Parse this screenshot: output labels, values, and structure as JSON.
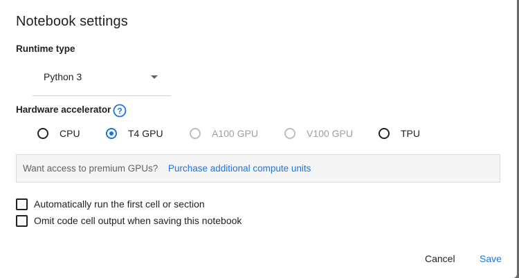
{
  "dialog": {
    "title": "Notebook settings"
  },
  "runtime": {
    "label": "Runtime type",
    "selected": "Python 3"
  },
  "hardware": {
    "label": "Hardware accelerator",
    "help_icon": "help-circle-icon",
    "options": [
      {
        "label": "CPU",
        "checked": false,
        "disabled": false
      },
      {
        "label": "T4 GPU",
        "checked": true,
        "disabled": false
      },
      {
        "label": "A100 GPU",
        "checked": false,
        "disabled": true
      },
      {
        "label": "V100 GPU",
        "checked": false,
        "disabled": true
      },
      {
        "label": "TPU",
        "checked": false,
        "disabled": false
      }
    ]
  },
  "premium": {
    "text": "Want access to premium GPUs?",
    "link": "Purchase additional compute units"
  },
  "checkboxes": [
    {
      "label": "Automatically run the first cell or section",
      "checked": false
    },
    {
      "label": "Omit code cell output when saving this notebook",
      "checked": false
    }
  ],
  "actions": {
    "cancel": "Cancel",
    "save": "Save"
  },
  "colors": {
    "accent": "#1a73e8",
    "disabled": "#9e9e9e",
    "text": "#202124"
  }
}
